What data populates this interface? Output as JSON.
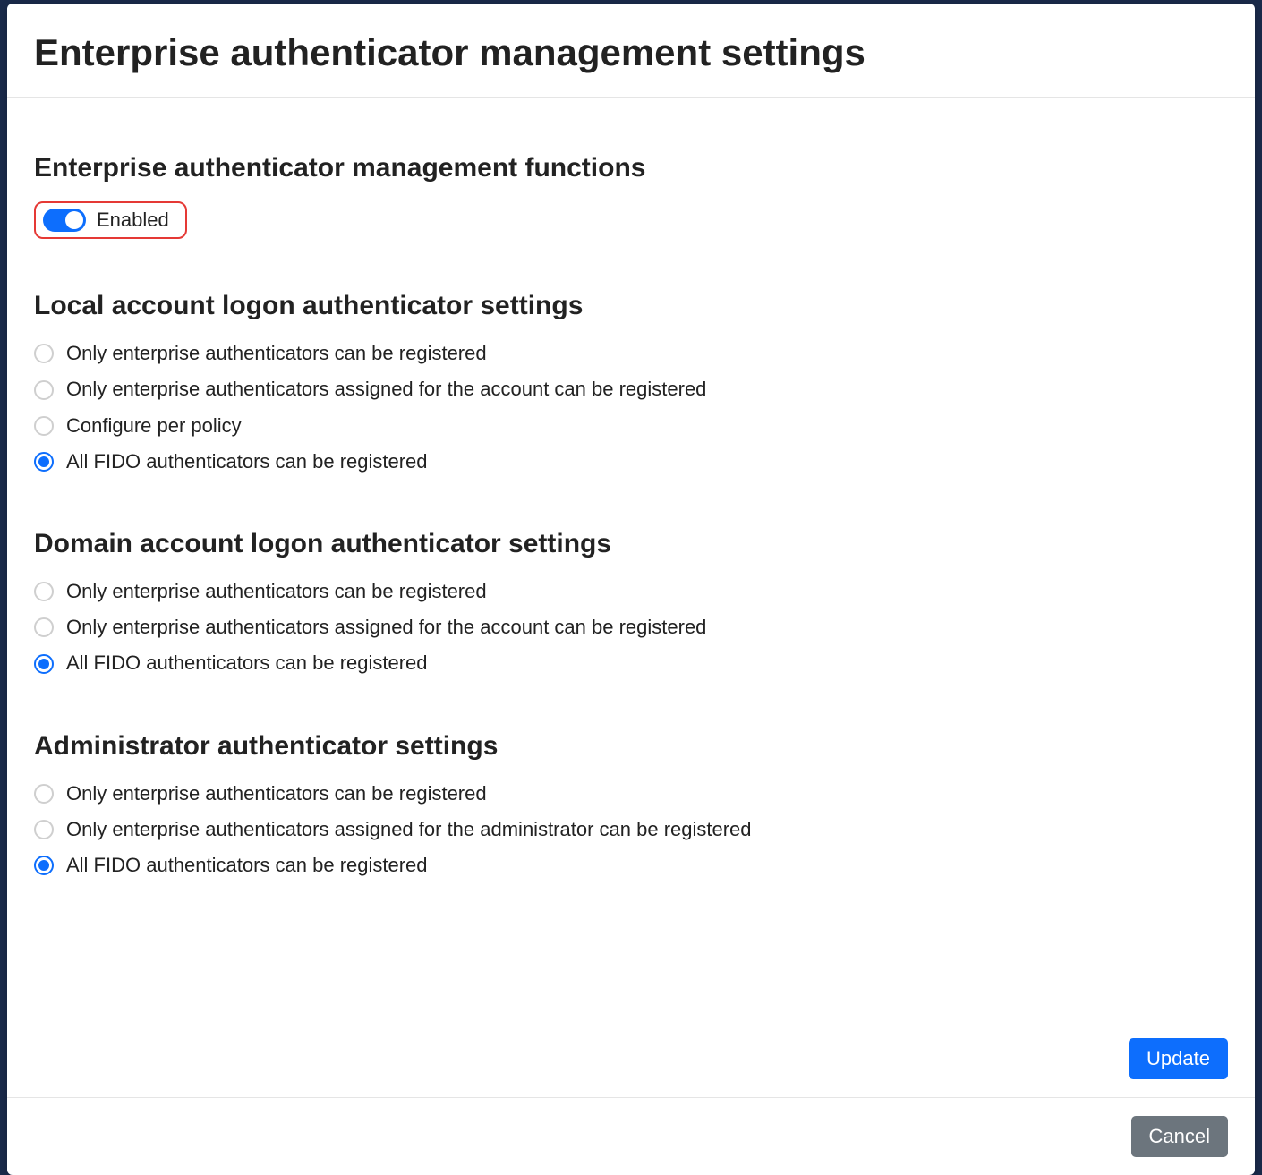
{
  "modal": {
    "title": "Enterprise authenticator management settings",
    "update_label": "Update",
    "cancel_label": "Cancel"
  },
  "section_functions": {
    "heading": "Enterprise authenticator management functions",
    "toggle_label": "Enabled",
    "toggle_state": true
  },
  "section_local": {
    "heading": "Local account logon authenticator settings",
    "options": [
      {
        "label": "Only enterprise authenticators can be registered",
        "selected": false
      },
      {
        "label": "Only enterprise authenticators assigned for the account can be registered",
        "selected": false
      },
      {
        "label": "Configure per policy",
        "selected": false
      },
      {
        "label": "All FIDO authenticators can be registered",
        "selected": true
      }
    ]
  },
  "section_domain": {
    "heading": "Domain account logon authenticator settings",
    "options": [
      {
        "label": "Only enterprise authenticators can be registered",
        "selected": false
      },
      {
        "label": "Only enterprise authenticators assigned for the account can be registered",
        "selected": false
      },
      {
        "label": "All FIDO authenticators can be registered",
        "selected": true
      }
    ]
  },
  "section_admin": {
    "heading": "Administrator authenticator settings",
    "options": [
      {
        "label": "Only enterprise authenticators can be registered",
        "selected": false
      },
      {
        "label": "Only enterprise authenticators assigned for the administrator can be registered",
        "selected": false
      },
      {
        "label": "All FIDO authenticators can be registered",
        "selected": true
      }
    ]
  }
}
